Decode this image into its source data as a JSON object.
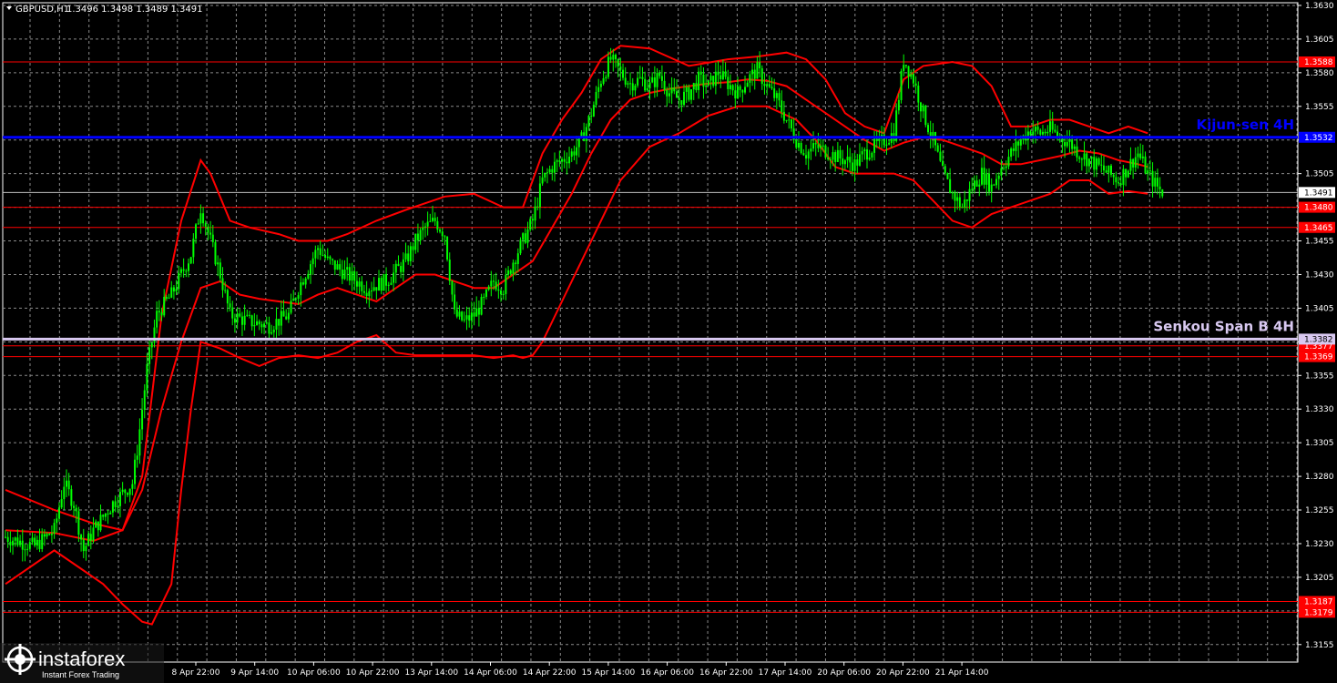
{
  "header": {
    "symbol": "GBPUSD,H1",
    "ohlc": "1.3496 1.3498 1.3489 1.3491"
  },
  "watermark": {
    "brand": "instaforex",
    "tagline": "Instant Forex Trading"
  },
  "chart_data": {
    "type": "candlestick",
    "symbol": "GBPUSD",
    "timeframe": "H1",
    "ylim": [
      1.3142,
      1.3632
    ],
    "grid": true,
    "y_ticks": [
      "1.3630",
      "1.3605",
      "1.3580",
      "1.3555",
      "1.3530",
      "1.3505",
      "1.3480",
      "1.3455",
      "1.3430",
      "1.3405",
      "1.3380",
      "1.3355",
      "1.3330",
      "1.3305",
      "1.3280",
      "1.3255",
      "1.3230",
      "1.3205",
      "1.3180",
      "1.3155"
    ],
    "x_ticks": [
      "8 Apr 22:00",
      "9 Apr 14:00",
      "10 Apr 06:00",
      "10 Apr 22:00",
      "13 Apr 14:00",
      "14 Apr 06:00",
      "14 Apr 22:00",
      "15 Apr 14:00",
      "16 Apr 06:00",
      "16 Apr 22:00",
      "17 Apr 14:00",
      "20 Apr 06:00",
      "20 Apr 22:00",
      "21 Apr 14:00"
    ],
    "bars_visible": 260,
    "current_price": "1.3491",
    "levels": [
      {
        "label": "1.3588",
        "value": 1.3588,
        "color": "#ff0000"
      },
      {
        "label": "1.3480",
        "value": 1.348,
        "color": "#ff0000"
      },
      {
        "label": "1.3465",
        "value": 1.3465,
        "color": "#ff0000"
      },
      {
        "label": "1.3377",
        "value": 1.3377,
        "color": "#ff0000"
      },
      {
        "label": "1.3369",
        "value": 1.3369,
        "color": "#ff0000"
      },
      {
        "label": "1.3187",
        "value": 1.3187,
        "color": "#ff0000"
      },
      {
        "label": "1.3179",
        "value": 1.3179,
        "color": "#ff0000"
      }
    ],
    "named_levels": [
      {
        "name": "Kijun-sen 4H",
        "value": 1.3532,
        "tag": "1.3532",
        "color": "#0000ff"
      },
      {
        "name": "Senkou Span B 4H",
        "value": 1.3382,
        "tag": "1.3382",
        "color": "#d8c8f0"
      }
    ],
    "price_path": [
      [
        0,
        1.3235
      ],
      [
        6,
        1.3228
      ],
      [
        10,
        1.324
      ],
      [
        12,
        1.3275
      ],
      [
        14,
        1.326
      ],
      [
        16,
        1.3225
      ],
      [
        18,
        1.324
      ],
      [
        22,
        1.326
      ],
      [
        26,
        1.3275
      ],
      [
        27,
        1.33
      ],
      [
        29,
        1.336
      ],
      [
        31,
        1.34
      ],
      [
        34,
        1.3415
      ],
      [
        36,
        1.343
      ],
      [
        38,
        1.3445
      ],
      [
        40,
        1.348
      ],
      [
        42,
        1.3455
      ],
      [
        44,
        1.343
      ],
      [
        46,
        1.34
      ],
      [
        50,
        1.3395
      ],
      [
        54,
        1.3392
      ],
      [
        58,
        1.34
      ],
      [
        60,
        1.342
      ],
      [
        62,
        1.3435
      ],
      [
        64,
        1.345
      ],
      [
        66,
        1.344
      ],
      [
        70,
        1.343
      ],
      [
        74,
        1.342
      ],
      [
        78,
        1.3425
      ],
      [
        82,
        1.344
      ],
      [
        84,
        1.3455
      ],
      [
        86,
        1.3465
      ],
      [
        88,
        1.347
      ],
      [
        90,
        1.346
      ],
      [
        92,
        1.34
      ],
      [
        94,
        1.3395
      ],
      [
        96,
        1.34
      ],
      [
        98,
        1.341
      ],
      [
        100,
        1.3425
      ],
      [
        102,
        1.342
      ],
      [
        104,
        1.344
      ],
      [
        106,
        1.3455
      ],
      [
        108,
        1.347
      ],
      [
        110,
        1.35
      ],
      [
        112,
        1.351
      ],
      [
        114,
        1.3515
      ],
      [
        116,
        1.352
      ],
      [
        118,
        1.353
      ],
      [
        120,
        1.355
      ],
      [
        122,
        1.3575
      ],
      [
        124,
        1.359
      ],
      [
        126,
        1.358
      ],
      [
        128,
        1.3572
      ],
      [
        130,
        1.3575
      ],
      [
        132,
        1.357
      ],
      [
        134,
        1.3578
      ],
      [
        136,
        1.3565
      ],
      [
        138,
        1.356
      ],
      [
        140,
        1.3565
      ],
      [
        142,
        1.3575
      ],
      [
        144,
        1.357
      ],
      [
        146,
        1.358
      ],
      [
        148,
        1.3572
      ],
      [
        150,
        1.3565
      ],
      [
        152,
        1.3575
      ],
      [
        154,
        1.3582
      ],
      [
        156,
        1.357
      ],
      [
        158,
        1.356
      ],
      [
        160,
        1.3545
      ],
      [
        162,
        1.353
      ],
      [
        164,
        1.352
      ],
      [
        166,
        1.3525
      ],
      [
        168,
        1.3522
      ],
      [
        170,
        1.3518
      ],
      [
        172,
        1.3515
      ],
      [
        174,
        1.3512
      ],
      [
        176,
        1.352
      ],
      [
        178,
        1.3525
      ],
      [
        180,
        1.353
      ],
      [
        182,
        1.3535
      ],
      [
        184,
        1.359
      ],
      [
        186,
        1.3575
      ],
      [
        188,
        1.355
      ],
      [
        190,
        1.353
      ],
      [
        192,
        1.3505
      ],
      [
        194,
        1.349
      ],
      [
        196,
        1.348
      ],
      [
        198,
        1.3495
      ],
      [
        200,
        1.3505
      ],
      [
        202,
        1.3495
      ],
      [
        204,
        1.351
      ],
      [
        206,
        1.352
      ],
      [
        208,
        1.353
      ],
      [
        210,
        1.3538
      ],
      [
        212,
        1.3535
      ],
      [
        214,
        1.3538
      ],
      [
        216,
        1.3532
      ],
      [
        218,
        1.3528
      ],
      [
        220,
        1.352
      ],
      [
        222,
        1.3515
      ],
      [
        224,
        1.351
      ],
      [
        226,
        1.3505
      ],
      [
        228,
        1.35
      ],
      [
        230,
        1.351
      ],
      [
        232,
        1.352
      ],
      [
        234,
        1.3505
      ],
      [
        236,
        1.3495
      ],
      [
        237,
        1.3491
      ]
    ],
    "bollinger_upper": [
      [
        0,
        1.327
      ],
      [
        10,
        1.3255
      ],
      [
        18,
        1.3245
      ],
      [
        24,
        1.324
      ],
      [
        28,
        1.328
      ],
      [
        32,
        1.34
      ],
      [
        36,
        1.347
      ],
      [
        40,
        1.3515
      ],
      [
        42,
        1.3505
      ],
      [
        46,
        1.347
      ],
      [
        50,
        1.3465
      ],
      [
        56,
        1.346
      ],
      [
        60,
        1.3455
      ],
      [
        66,
        1.3455
      ],
      [
        70,
        1.346
      ],
      [
        76,
        1.347
      ],
      [
        82,
        1.3478
      ],
      [
        90,
        1.3488
      ],
      [
        96,
        1.349
      ],
      [
        102,
        1.348
      ],
      [
        106,
        1.348
      ],
      [
        110,
        1.352
      ],
      [
        114,
        1.3545
      ],
      [
        118,
        1.3565
      ],
      [
        122,
        1.359
      ],
      [
        126,
        1.36
      ],
      [
        132,
        1.3598
      ],
      [
        140,
        1.3585
      ],
      [
        148,
        1.359
      ],
      [
        154,
        1.3592
      ],
      [
        160,
        1.3595
      ],
      [
        164,
        1.359
      ],
      [
        168,
        1.3575
      ],
      [
        172,
        1.355
      ],
      [
        176,
        1.354
      ],
      [
        180,
        1.3535
      ],
      [
        184,
        1.3575
      ],
      [
        188,
        1.3585
      ],
      [
        194,
        1.3588
      ],
      [
        198,
        1.3585
      ],
      [
        202,
        1.357
      ],
      [
        206,
        1.354
      ],
      [
        210,
        1.354
      ],
      [
        214,
        1.3545
      ],
      [
        218,
        1.3545
      ],
      [
        222,
        1.354
      ],
      [
        226,
        1.3535
      ],
      [
        230,
        1.354
      ],
      [
        234,
        1.3535
      ]
    ],
    "bollinger_lower": [
      [
        0,
        1.32
      ],
      [
        10,
        1.3225
      ],
      [
        16,
        1.321
      ],
      [
        20,
        1.32
      ],
      [
        24,
        1.3185
      ],
      [
        28,
        1.3172
      ],
      [
        30,
        1.317
      ],
      [
        34,
        1.32
      ],
      [
        36,
        1.327
      ],
      [
        38,
        1.333
      ],
      [
        40,
        1.338
      ],
      [
        44,
        1.3375
      ],
      [
        48,
        1.3368
      ],
      [
        52,
        1.3362
      ],
      [
        56,
        1.3368
      ],
      [
        60,
        1.337
      ],
      [
        64,
        1.3368
      ],
      [
        68,
        1.3372
      ],
      [
        72,
        1.338
      ],
      [
        76,
        1.3385
      ],
      [
        80,
        1.3372
      ],
      [
        84,
        1.337
      ],
      [
        90,
        1.337
      ],
      [
        96,
        1.337
      ],
      [
        100,
        1.3368
      ],
      [
        104,
        1.337
      ],
      [
        106,
        1.3368
      ],
      [
        108,
        1.337
      ],
      [
        110,
        1.338
      ],
      [
        114,
        1.341
      ],
      [
        118,
        1.344
      ],
      [
        122,
        1.347
      ],
      [
        126,
        1.35
      ],
      [
        132,
        1.3525
      ],
      [
        138,
        1.3535
      ],
      [
        144,
        1.3548
      ],
      [
        150,
        1.3555
      ],
      [
        156,
        1.3555
      ],
      [
        162,
        1.3545
      ],
      [
        166,
        1.353
      ],
      [
        170,
        1.351
      ],
      [
        174,
        1.3505
      ],
      [
        178,
        1.3505
      ],
      [
        182,
        1.3505
      ],
      [
        186,
        1.35
      ],
      [
        190,
        1.3485
      ],
      [
        194,
        1.347
      ],
      [
        198,
        1.3465
      ],
      [
        202,
        1.3475
      ],
      [
        206,
        1.348
      ],
      [
        210,
        1.3485
      ],
      [
        214,
        1.349
      ],
      [
        218,
        1.35
      ],
      [
        222,
        1.35
      ],
      [
        226,
        1.349
      ],
      [
        230,
        1.3492
      ],
      [
        234,
        1.349
      ]
    ],
    "bollinger_mid": [
      [
        0,
        1.324
      ],
      [
        10,
        1.3238
      ],
      [
        18,
        1.3232
      ],
      [
        24,
        1.324
      ],
      [
        28,
        1.327
      ],
      [
        32,
        1.333
      ],
      [
        36,
        1.338
      ],
      [
        40,
        1.342
      ],
      [
        44,
        1.3425
      ],
      [
        48,
        1.3415
      ],
      [
        52,
        1.3412
      ],
      [
        56,
        1.341
      ],
      [
        60,
        1.3408
      ],
      [
        64,
        1.3415
      ],
      [
        68,
        1.342
      ],
      [
        72,
        1.3415
      ],
      [
        76,
        1.341
      ],
      [
        80,
        1.342
      ],
      [
        84,
        1.343
      ],
      [
        88,
        1.343
      ],
      [
        92,
        1.3425
      ],
      [
        96,
        1.342
      ],
      [
        100,
        1.342
      ],
      [
        104,
        1.343
      ],
      [
        108,
        1.344
      ],
      [
        112,
        1.3465
      ],
      [
        116,
        1.349
      ],
      [
        120,
        1.352
      ],
      [
        124,
        1.3545
      ],
      [
        128,
        1.356
      ],
      [
        132,
        1.3565
      ],
      [
        136,
        1.3568
      ],
      [
        140,
        1.357
      ],
      [
        144,
        1.3572
      ],
      [
        148,
        1.3573
      ],
      [
        152,
        1.3575
      ],
      [
        156,
        1.3574
      ],
      [
        160,
        1.357
      ],
      [
        164,
        1.356
      ],
      [
        168,
        1.355
      ],
      [
        172,
        1.354
      ],
      [
        176,
        1.353
      ],
      [
        180,
        1.3522
      ],
      [
        184,
        1.3528
      ],
      [
        188,
        1.3532
      ],
      [
        192,
        1.353
      ],
      [
        196,
        1.3525
      ],
      [
        200,
        1.352
      ],
      [
        204,
        1.3512
      ],
      [
        208,
        1.3512
      ],
      [
        212,
        1.3515
      ],
      [
        216,
        1.3518
      ],
      [
        220,
        1.3522
      ],
      [
        224,
        1.352
      ],
      [
        228,
        1.3515
      ],
      [
        232,
        1.3512
      ],
      [
        234,
        1.351
      ]
    ]
  }
}
